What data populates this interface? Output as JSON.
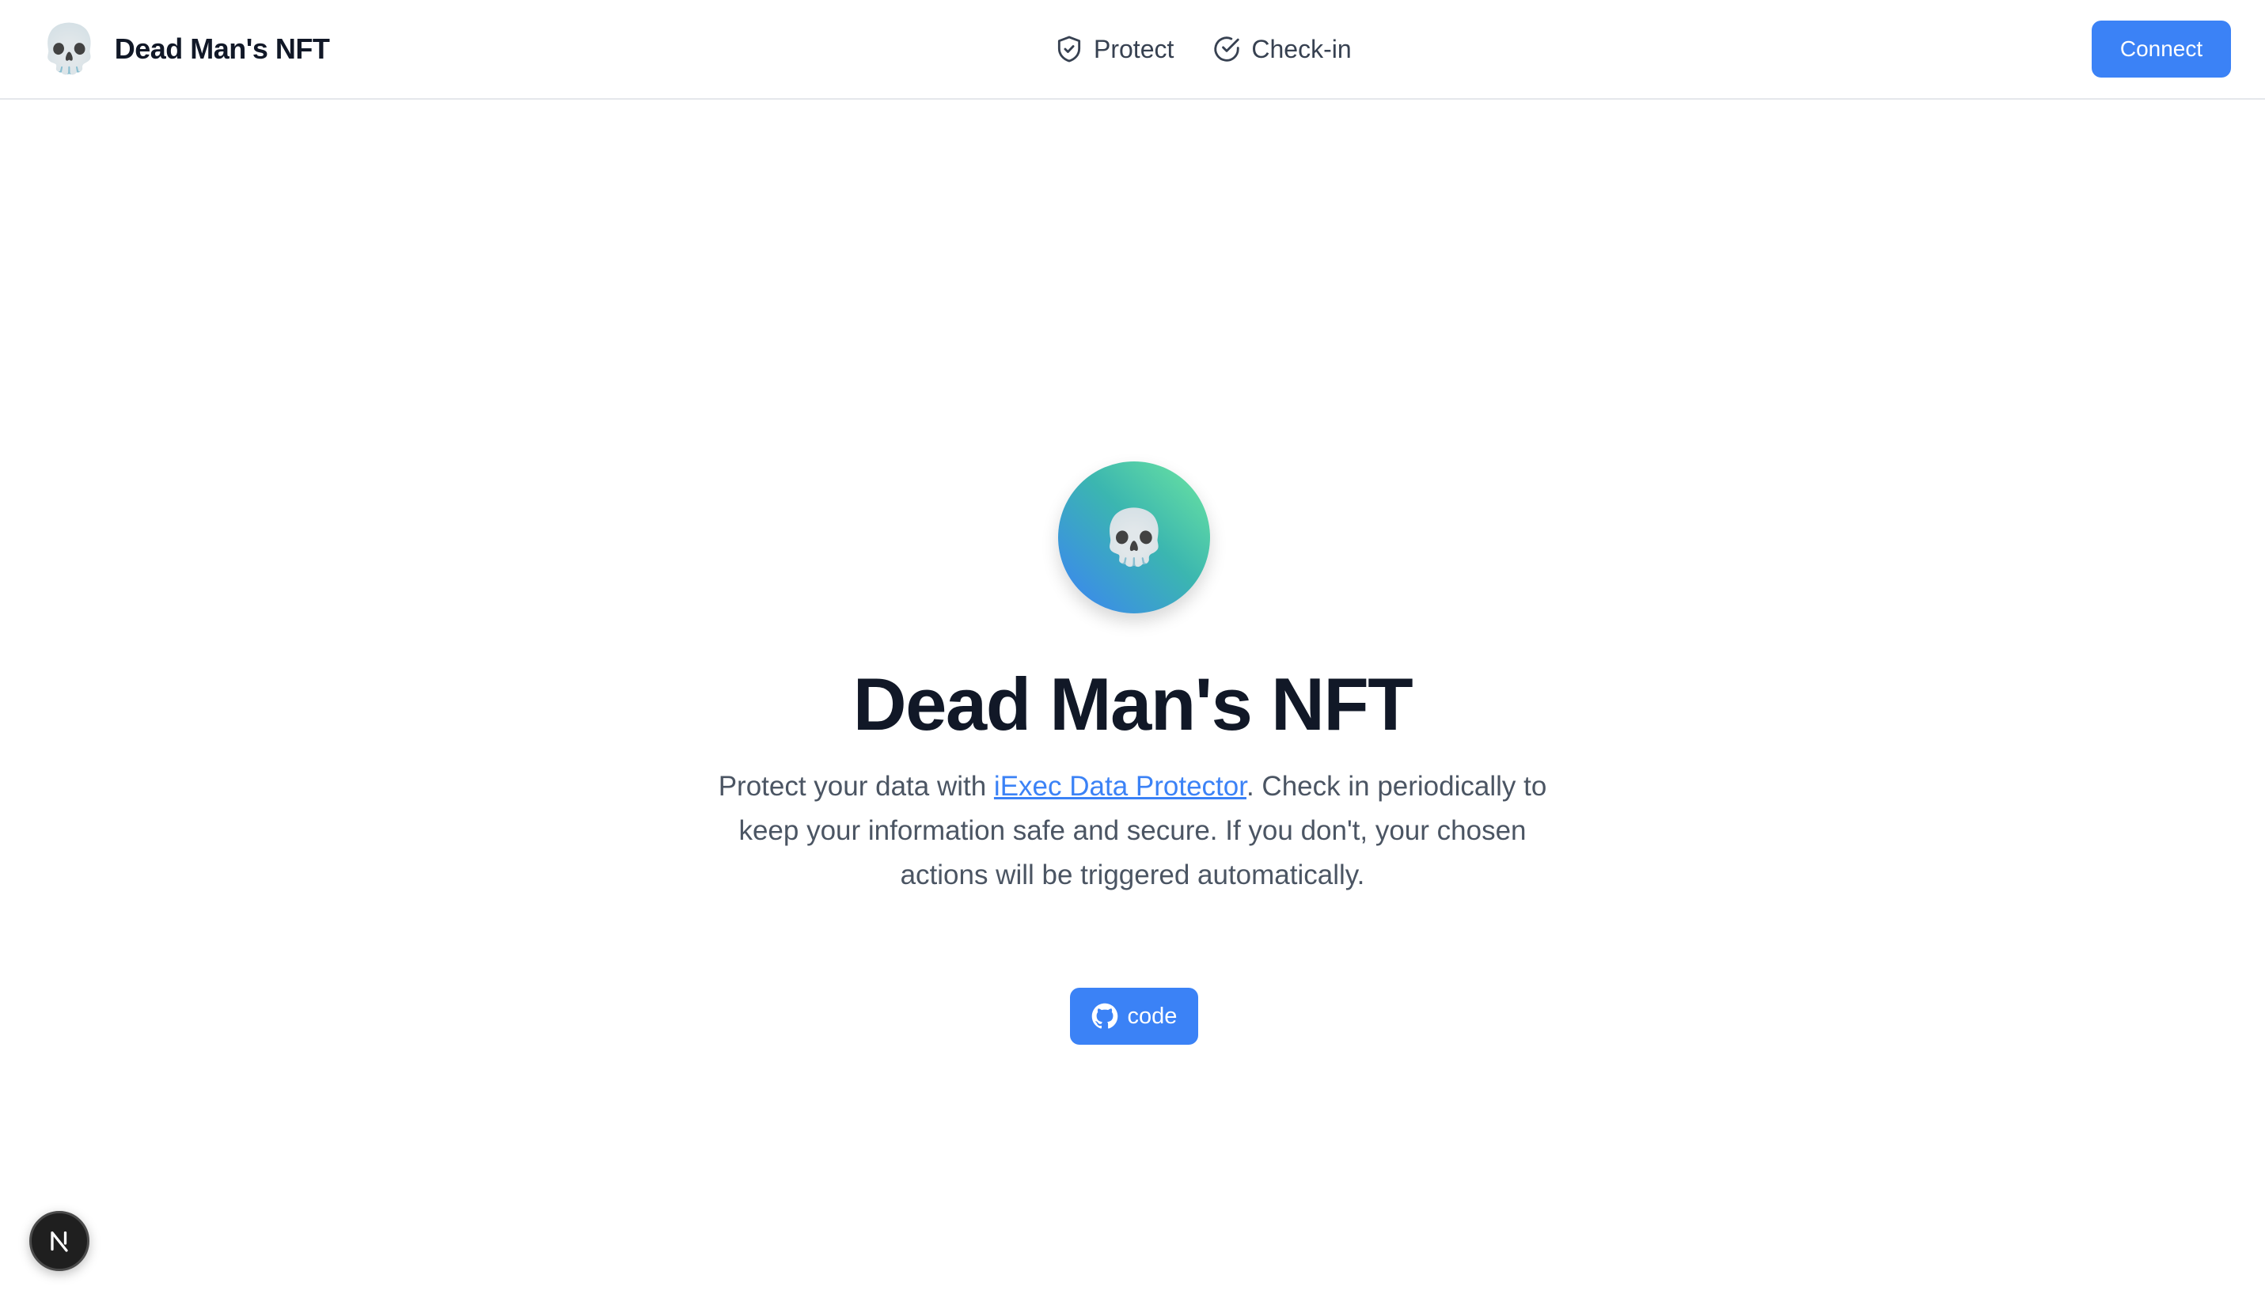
{
  "header": {
    "brand": {
      "logo_emoji": "💀",
      "name": "Dead Man's NFT"
    },
    "nav": [
      {
        "label": "Protect",
        "icon": "shield-check-icon"
      },
      {
        "label": "Check-in",
        "icon": "circle-check-icon"
      }
    ],
    "connect_label": "Connect"
  },
  "hero": {
    "avatar_emoji": "💀",
    "title": "Dead Man's NFT",
    "text_before_link": "Protect your data with ",
    "link_text": "iExec Data Protector",
    "text_after_link": ". Check in periodically to keep your information safe and secure. If you don't, your chosen actions will be triggered automatically.",
    "code_button_label": "code",
    "code_button_icon": "github-icon"
  },
  "dev_indicator": {
    "icon": "nextjs-icon"
  },
  "colors": {
    "accent": "#3b82f6",
    "title": "#111827",
    "body_text": "#4b5563",
    "gradient_start": "#6ee7a0",
    "gradient_end": "#3b82f6"
  }
}
